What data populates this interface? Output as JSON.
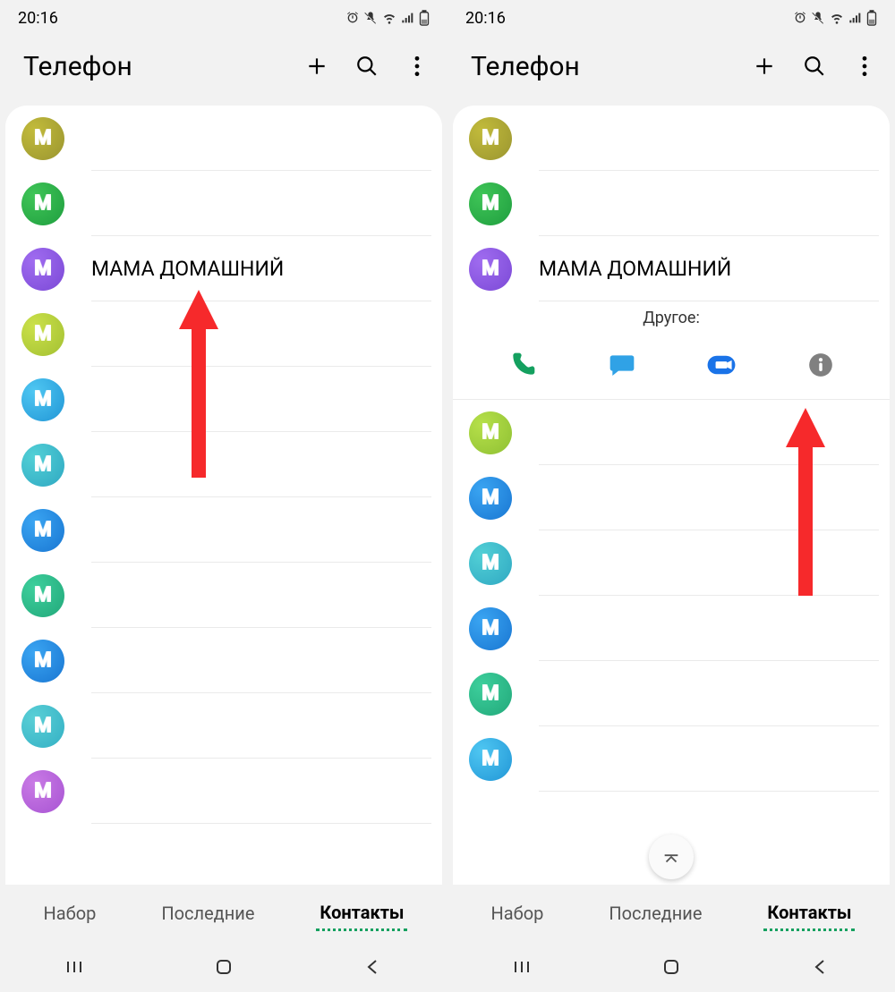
{
  "status": {
    "time": "20:16"
  },
  "header": {
    "title": "Телефон"
  },
  "contact_letter": "М",
  "left_screen": {
    "contacts": [
      {
        "name": "",
        "grad": [
          "#c2bb3b",
          "#9a9530"
        ]
      },
      {
        "name": "",
        "grad": [
          "#3fc557",
          "#1f9e3f"
        ]
      },
      {
        "name": "МАМА ДОМАШНИЙ",
        "grad": [
          "#a06cf0",
          "#7b49d6"
        ]
      },
      {
        "name": "",
        "grad": [
          "#cbe14a",
          "#a3c032"
        ]
      },
      {
        "name": "",
        "grad": [
          "#4fc7f2",
          "#2196d6"
        ]
      },
      {
        "name": "",
        "grad": [
          "#52d0d6",
          "#2fa8c2"
        ]
      },
      {
        "name": "",
        "grad": [
          "#3aa5f2",
          "#1976d2"
        ]
      },
      {
        "name": "",
        "grad": [
          "#3dcf9c",
          "#22a87a"
        ]
      },
      {
        "name": "",
        "grad": [
          "#3aa5f2",
          "#1976d2"
        ]
      },
      {
        "name": "",
        "grad": [
          "#5acfd6",
          "#33b0c4"
        ]
      },
      {
        "name": "",
        "grad": [
          "#c97ae5",
          "#a854d3"
        ]
      }
    ]
  },
  "right_screen": {
    "contacts": [
      {
        "name": "",
        "grad": [
          "#c2bb3b",
          "#9a9530"
        ]
      },
      {
        "name": "",
        "grad": [
          "#3fc557",
          "#1f9e3f"
        ]
      },
      {
        "name": "МАМА ДОМАШНИЙ",
        "grad": [
          "#a06cf0",
          "#7b49d6"
        ],
        "expanded": true
      },
      {
        "name": "",
        "grad": [
          "#b6e04a",
          "#8fc033"
        ]
      },
      {
        "name": "",
        "grad": [
          "#3aa5f2",
          "#1976d2"
        ]
      },
      {
        "name": "",
        "grad": [
          "#52d0d6",
          "#2fa8c2"
        ]
      },
      {
        "name": "",
        "grad": [
          "#3aa5f2",
          "#1976d2"
        ]
      },
      {
        "name": "",
        "grad": [
          "#3dcf9c",
          "#22a87a"
        ]
      },
      {
        "name": "",
        "grad": [
          "#4fc7f2",
          "#2196d6"
        ]
      }
    ],
    "expanded_label": "Другое:"
  },
  "tabs": {
    "dial": "Набор",
    "recent": "Последние",
    "contacts": "Контакты"
  }
}
